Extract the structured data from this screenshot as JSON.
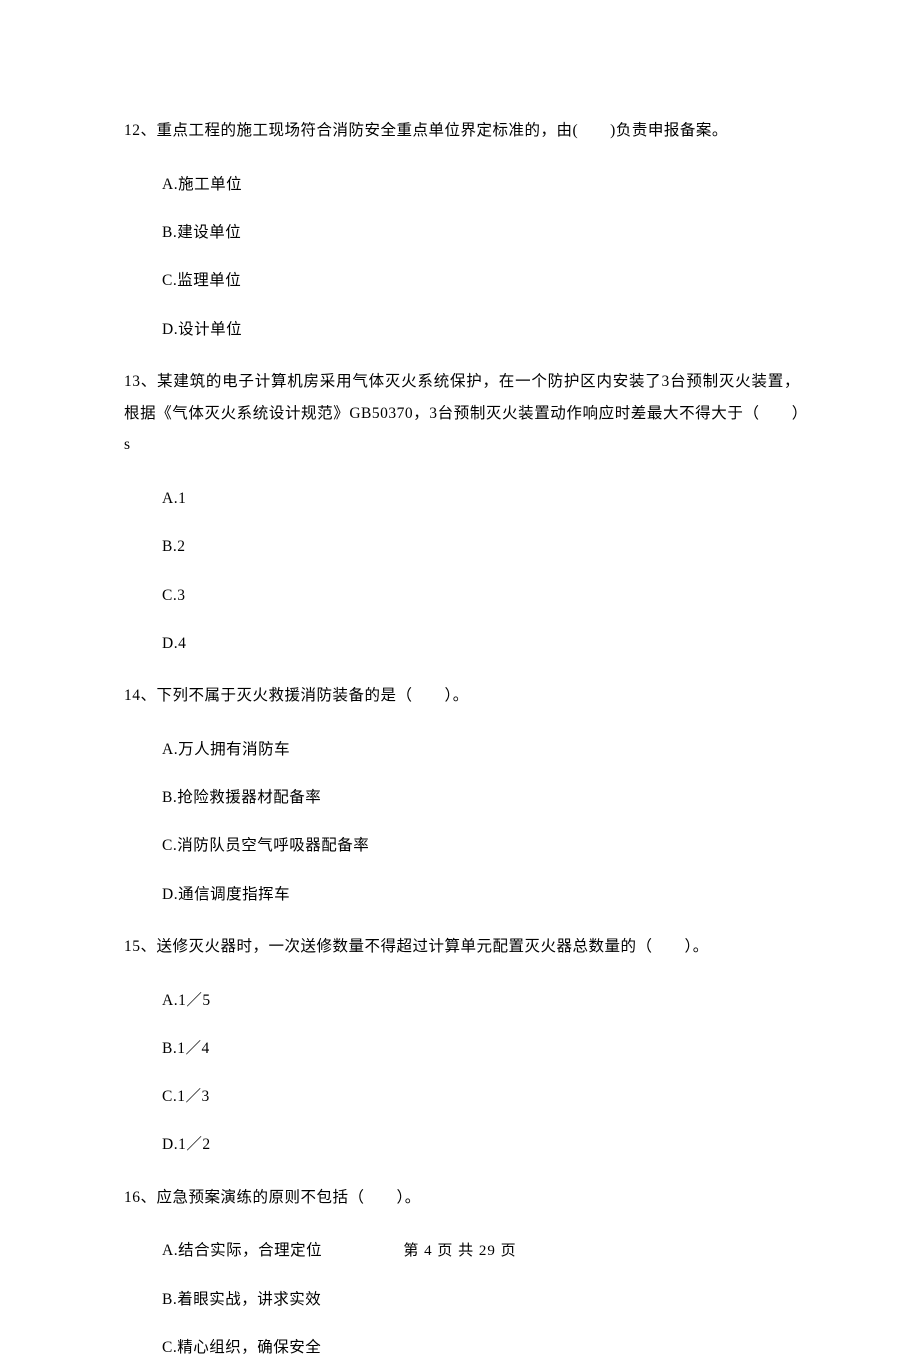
{
  "questions": [
    {
      "stem": "12、重点工程的施工现场符合消防安全重点单位界定标准的，由(　　)负责申报备案。",
      "options": [
        "A.施工单位",
        "B.建设单位",
        "C.监理单位",
        "D.设计单位"
      ]
    },
    {
      "stem": "13、某建筑的电子计算机房采用气体灭火系统保护，在一个防护区内安装了3台预制灭火装置，根据《气体灭火系统设计规范》GB50370，3台预制灭火装置动作响应时差最大不得大于（　　）s",
      "options": [
        "A.1",
        "B.2",
        "C.3",
        "D.4"
      ]
    },
    {
      "stem": "14、下列不属于灭火救援消防装备的是（　　）。",
      "options": [
        "A.万人拥有消防车",
        "B.抢险救援器材配备率",
        "C.消防队员空气呼吸器配备率",
        "D.通信调度指挥车"
      ]
    },
    {
      "stem": "15、送修灭火器时，一次送修数量不得超过计算单元配置灭火器总数量的（　　）。",
      "options": [
        "A.1／5",
        "B.1／4",
        "C.1／3",
        "D.1／2"
      ]
    },
    {
      "stem": "16、应急预案演练的原则不包括（　　）。",
      "options": [
        "A.结合实际，合理定位",
        "B.着眼实战，讲求实效",
        "C.精心组织，确保安全"
      ]
    }
  ],
  "footer": "第 4 页 共 29 页"
}
